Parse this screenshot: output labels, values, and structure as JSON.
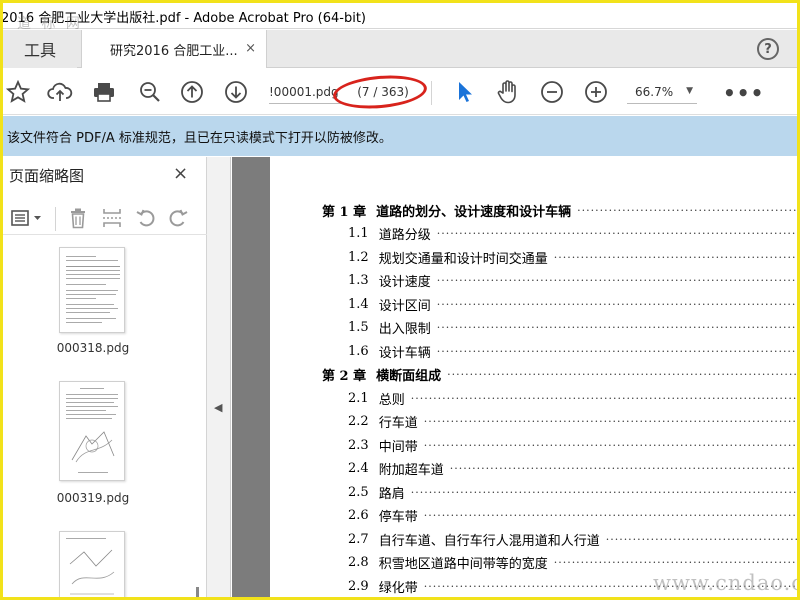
{
  "window": {
    "title": "2016 合肥工业大学出版社.pdf - Adobe Acrobat Pro (64-bit)",
    "watermark_top": "道 标 网"
  },
  "tabs": {
    "tools_label": "工具",
    "doc_label": "研究2016 合肥工业...",
    "close_glyph": "×",
    "help_glyph": "?"
  },
  "toolbar": {
    "page_field": "!00001.pdg",
    "page_count": "(7 / 363)",
    "zoom": "66.7%",
    "more": "•••"
  },
  "notice": {
    "text": "该文件符合 PDF/A 标准规范，且已在只读模式下打开以防被修改。"
  },
  "sidebar": {
    "title": "页面缩略图",
    "close_glyph": "×",
    "thumbnails": [
      {
        "label": "000318.pdg"
      },
      {
        "label": "000319.pdg"
      },
      {
        "label": ""
      }
    ]
  },
  "document": {
    "toc": [
      {
        "num": "第 1 章",
        "text": "道路的划分、设计速度和设计车辆",
        "level": 0
      },
      {
        "num": "1.1",
        "text": "道路分级",
        "level": 1
      },
      {
        "num": "1.2",
        "text": "规划交通量和设计时间交通量",
        "level": 1
      },
      {
        "num": "1.3",
        "text": "设计速度",
        "level": 1
      },
      {
        "num": "1.4",
        "text": "设计区间",
        "level": 1
      },
      {
        "num": "1.5",
        "text": "出入限制",
        "level": 1
      },
      {
        "num": "1.6",
        "text": "设计车辆",
        "level": 1
      },
      {
        "num": "第 2 章",
        "text": "横断面组成",
        "level": 0
      },
      {
        "num": "2.1",
        "text": "总则",
        "level": 1
      },
      {
        "num": "2.2",
        "text": "行车道",
        "level": 1
      },
      {
        "num": "2.3",
        "text": "中间带",
        "level": 1
      },
      {
        "num": "2.4",
        "text": "附加超车道",
        "level": 1
      },
      {
        "num": "2.5",
        "text": "路肩",
        "level": 1
      },
      {
        "num": "2.6",
        "text": "停车带",
        "level": 1
      },
      {
        "num": "2.7",
        "text": "自行车道、自行车行人混用道和人行道",
        "level": 1
      },
      {
        "num": "2.8",
        "text": "积雪地区道路中间带等的宽度",
        "level": 1
      },
      {
        "num": "2.9",
        "text": "绿化带",
        "level": 1
      }
    ],
    "watermark_bottom": "www.cndao.com"
  },
  "colors": {
    "frame": "#f2e21a",
    "notice_bg": "#bad7ed",
    "select_tool": "#1a73d9",
    "annotation_ring": "#d8231c",
    "doc_bg": "#7c7c7c"
  }
}
